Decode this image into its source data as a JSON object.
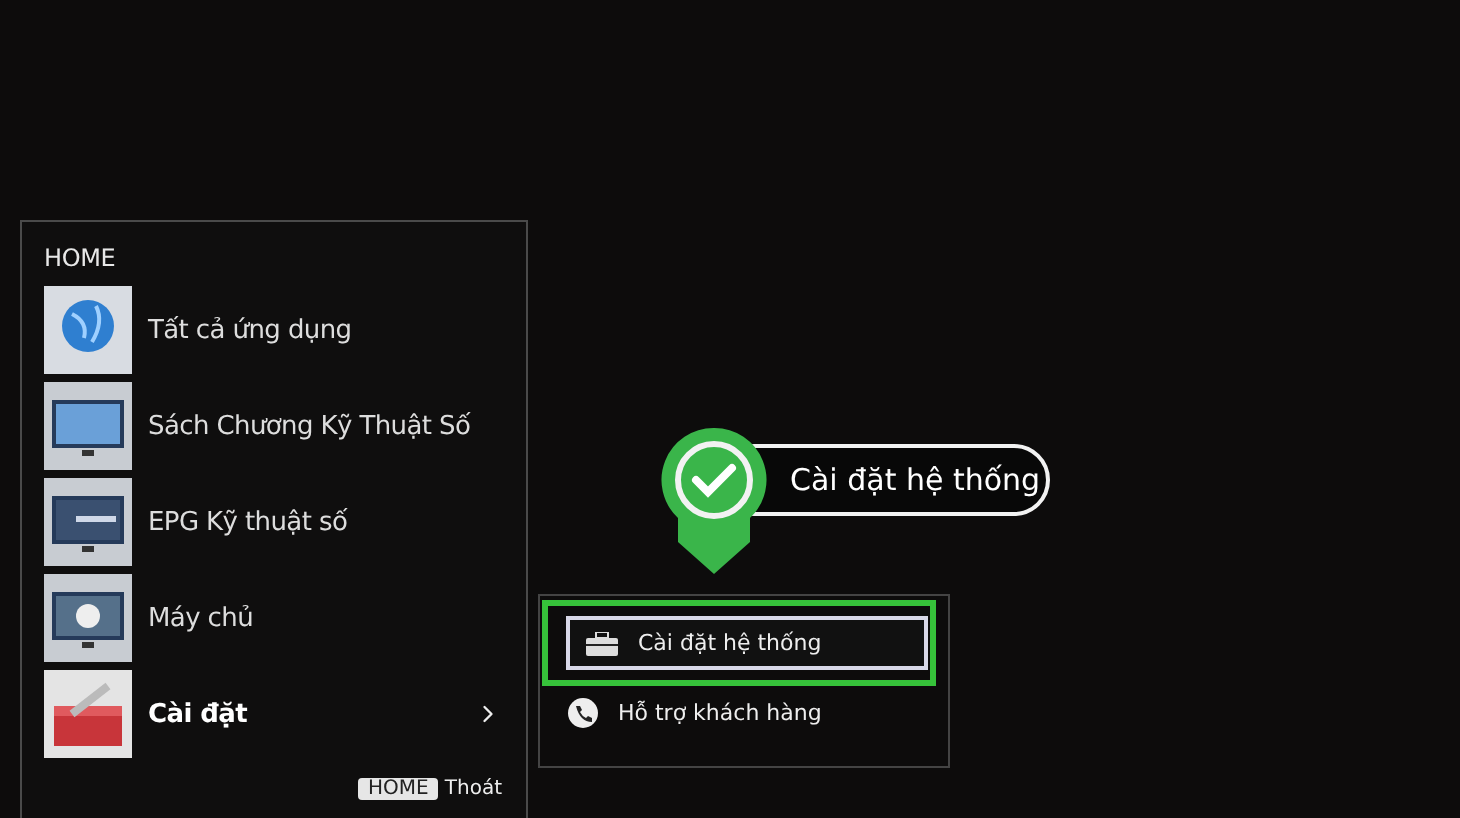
{
  "menu": {
    "title": "HOME",
    "items": [
      {
        "label": "Tất cả ứng dụng",
        "kind": "globe",
        "selected": false,
        "has_submenu": false
      },
      {
        "label": "Sách Chương Kỹ Thuật Số",
        "kind": "tv",
        "selected": false,
        "has_submenu": false
      },
      {
        "label": "EPG Kỹ thuật số",
        "kind": "guide",
        "selected": false,
        "has_submenu": false
      },
      {
        "label": "Máy chủ",
        "kind": "media",
        "selected": false,
        "has_submenu": false
      },
      {
        "label": "Cài đặt",
        "kind": "toolbox",
        "selected": true,
        "has_submenu": true
      }
    ]
  },
  "footer": {
    "key": "HOME",
    "label": "Thoát"
  },
  "submenu": {
    "items": [
      {
        "label": "Cài đặt hệ thống",
        "kind": "toolbox",
        "selected": true
      },
      {
        "label": "Hỗ trợ khách hàng",
        "kind": "phone",
        "selected": false
      }
    ]
  },
  "callout": {
    "label": "Cài đặt hệ thống"
  }
}
